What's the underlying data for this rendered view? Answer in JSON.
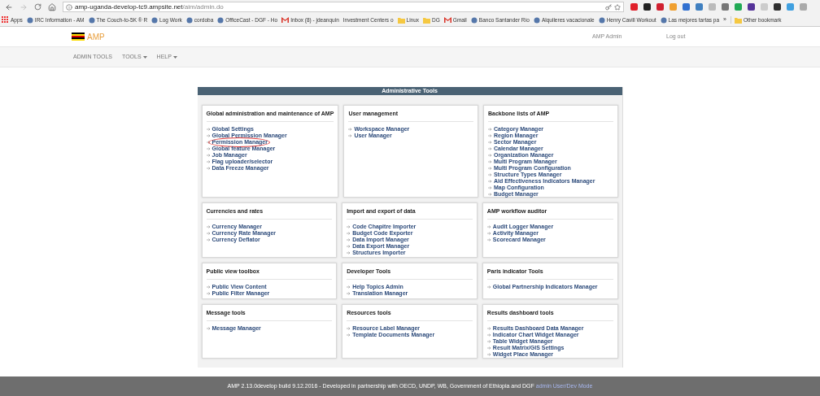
{
  "browser": {
    "url_host": "amp-uganda-develop-tc9.ampsite.net",
    "url_path": "/aim/admin.do",
    "bookmarks": [
      {
        "label": "Apps",
        "kind": "apps"
      },
      {
        "label": "IRC Information - AM",
        "kind": "site"
      },
      {
        "label": "The Couch-to-5K ® R",
        "kind": "site"
      },
      {
        "label": "Log Work",
        "kind": "site"
      },
      {
        "label": "cordoba",
        "kind": "site"
      },
      {
        "label": "OfficeCast - DGF - Ho",
        "kind": "site"
      },
      {
        "label": "Inbox (8) - jdeanquin",
        "kind": "mail"
      },
      {
        "label": "Investment Centers o",
        "kind": "blank"
      },
      {
        "label": "Linux",
        "kind": "folder"
      },
      {
        "label": "DG",
        "kind": "folder"
      },
      {
        "label": "Gmail",
        "kind": "mail"
      },
      {
        "label": "Banco Santander Río",
        "kind": "site"
      },
      {
        "label": "Alquileres vacacionale",
        "kind": "site"
      },
      {
        "label": "Henry Cavill Workout",
        "kind": "site"
      },
      {
        "label": "Las mejores tartas pa",
        "kind": "site"
      }
    ],
    "overflow": "»",
    "other_bookmarks": "Other bookmark"
  },
  "header": {
    "logo_text": "AMP",
    "user": "AMP Admin",
    "logout": "Log out"
  },
  "nav": [
    {
      "label": "ADMIN TOOLS",
      "dropdown": false
    },
    {
      "label": "TOOLS",
      "dropdown": true
    },
    {
      "label": "HELP",
      "dropdown": true
    }
  ],
  "panel": {
    "title": "Administrative Tools",
    "rows": [
      [
        {
          "title": "Global administration and maintenance of AMP",
          "items": [
            {
              "label": "Global Settings",
              "circled": false
            },
            {
              "label": "Global Permission Manager",
              "circled": false
            },
            {
              "label": "Permission Manager",
              "circled": true
            },
            {
              "label": "Global feature Manager",
              "circled": false
            },
            {
              "label": "Job Manager",
              "circled": false
            },
            {
              "label": "Flag uploader/selector",
              "circled": false
            },
            {
              "label": "Data Freeze Manager",
              "circled": false
            }
          ]
        },
        {
          "title": "User management",
          "items": [
            {
              "label": "Workspace Manager",
              "circled": false
            },
            {
              "label": "User Manager",
              "circled": false
            }
          ]
        },
        {
          "title": "Backbone lists of AMP",
          "items": [
            {
              "label": "Category Manager",
              "circled": false
            },
            {
              "label": "Region Manager",
              "circled": false
            },
            {
              "label": "Sector Manager",
              "circled": false
            },
            {
              "label": "Calendar Manager",
              "circled": false
            },
            {
              "label": "Organization Manager",
              "circled": false
            },
            {
              "label": "Multi Program Manager",
              "circled": false
            },
            {
              "label": "Multi Program Configuration",
              "circled": false
            },
            {
              "label": "Structure Types Manager",
              "circled": false
            },
            {
              "label": "Aid Effectiveness Indicators Manager",
              "circled": false
            },
            {
              "label": "Map Configuration",
              "circled": false
            },
            {
              "label": "Budget Manager",
              "circled": false
            }
          ]
        }
      ],
      [
        {
          "title": "Currencies and rates",
          "items": [
            {
              "label": "Currency Manager",
              "circled": false
            },
            {
              "label": "Currency Rate Manager",
              "circled": false
            },
            {
              "label": "Currency Deflator",
              "circled": false
            }
          ]
        },
        {
          "title": "Import and export of data",
          "items": [
            {
              "label": "Code Chapitre Importer",
              "circled": false
            },
            {
              "label": "Budget Code Exporter",
              "circled": false
            },
            {
              "label": "Data Import Manager",
              "circled": false
            },
            {
              "label": "Data Export Manager",
              "circled": false
            },
            {
              "label": "Structures Importer",
              "circled": false
            }
          ]
        },
        {
          "title": "AMP workflow auditor",
          "items": [
            {
              "label": "Audit Logger Manager",
              "circled": false
            },
            {
              "label": "Activity Manager",
              "circled": false
            },
            {
              "label": "Scorecard Manager",
              "circled": false
            }
          ]
        }
      ],
      [
        {
          "title": "Public view toolbox",
          "items": [
            {
              "label": "Public View Content",
              "circled": false
            },
            {
              "label": "Public Filter Manager",
              "circled": false
            }
          ]
        },
        {
          "title": "Developer Tools",
          "items": [
            {
              "label": "Help Topics Admin",
              "circled": false
            },
            {
              "label": "Translation Manager",
              "circled": false
            }
          ]
        },
        {
          "title": "Paris indicator Tools",
          "items": [
            {
              "label": "Global Partnership Indicators Manager",
              "circled": false
            }
          ]
        }
      ],
      [
        {
          "title": "Message tools",
          "items": [
            {
              "label": "Message Manager",
              "circled": false
            }
          ]
        },
        {
          "title": "Resources tools",
          "items": [
            {
              "label": "Resource Label Manager",
              "circled": false
            },
            {
              "label": "Template Documents Manager",
              "circled": false
            }
          ]
        },
        {
          "title": "Results dashboard tools",
          "items": [
            {
              "label": "Results Dashboard Data Manager",
              "circled": false
            },
            {
              "label": "Indicator Chart Widget Manager",
              "circled": false
            },
            {
              "label": "Table Widget Manager",
              "circled": false
            },
            {
              "label": "Result Matrix/GIS Settings",
              "circled": false
            },
            {
              "label": "Widget Place Manager",
              "circled": false
            }
          ]
        }
      ]
    ]
  },
  "footer": {
    "text": "AMP 2.13.0develop build 9.12.2016 - Developed in partnership with OECD, UNDP, WB, Government of Ethiopia and DGF",
    "link": "admin User/Dev Mode"
  }
}
